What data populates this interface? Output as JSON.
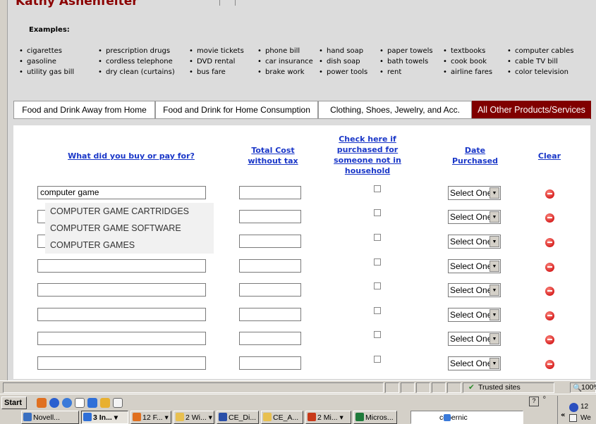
{
  "header": {
    "user_name": "Kathy Ashenfelter",
    "examples_title": "Examples:"
  },
  "examples": [
    [
      "cigarettes",
      "gasoline",
      "utility gas bill"
    ],
    [
      "prescription drugs",
      "cordless telephone",
      "dry clean (curtains)"
    ],
    [
      "movie tickets",
      "DVD rental",
      "bus fare"
    ],
    [
      "phone bill",
      "car insurance",
      "brake work"
    ],
    [
      "hand soap",
      "dish soap",
      "power tools"
    ],
    [
      "paper towels",
      "bath towels",
      "rent"
    ],
    [
      "textbooks",
      "cook book",
      "airline fares"
    ],
    [
      "computer cables",
      "cable TV bill",
      "color television"
    ]
  ],
  "tabs": [
    {
      "label": "Food and Drink Away from Home",
      "active": true
    },
    {
      "label": "Food and Drink for Home Consumption",
      "active": false
    },
    {
      "label": "Clothing, Shoes, Jewelry, and Acc.",
      "active": false
    },
    {
      "label": "All Other Products/Services",
      "active": false
    }
  ],
  "table": {
    "col_item": "What did you buy or pay for?",
    "col_cost": "Total Cost without tax",
    "col_check": "Check here if purchased for someone not in household",
    "col_date": "Date Purchased",
    "col_clear": "Clear",
    "row_count": 8,
    "first_row_value": "computer game",
    "select_placeholder": "Select One"
  },
  "autocomplete": [
    "COMPUTER GAME CARTRIDGES",
    "COMPUTER GAME SOFTWARE",
    "COMPUTER GAMES"
  ],
  "statusbar": {
    "zone": "Trusted sites",
    "zoom": "100%"
  },
  "taskbar": {
    "start": "Start",
    "tasks": [
      "Novell...",
      "3 In...",
      "12 F...",
      "2 Wi...",
      "CE_Di...",
      "CE_A...",
      "2 Mi...",
      "Micros..."
    ],
    "address_text": "copernic",
    "clock_top": "12",
    "clock_bottom": "We"
  },
  "colors": {
    "accent_dark_red": "#800000",
    "link_blue": "#1a37c8",
    "clear_icon": "#d62020"
  }
}
